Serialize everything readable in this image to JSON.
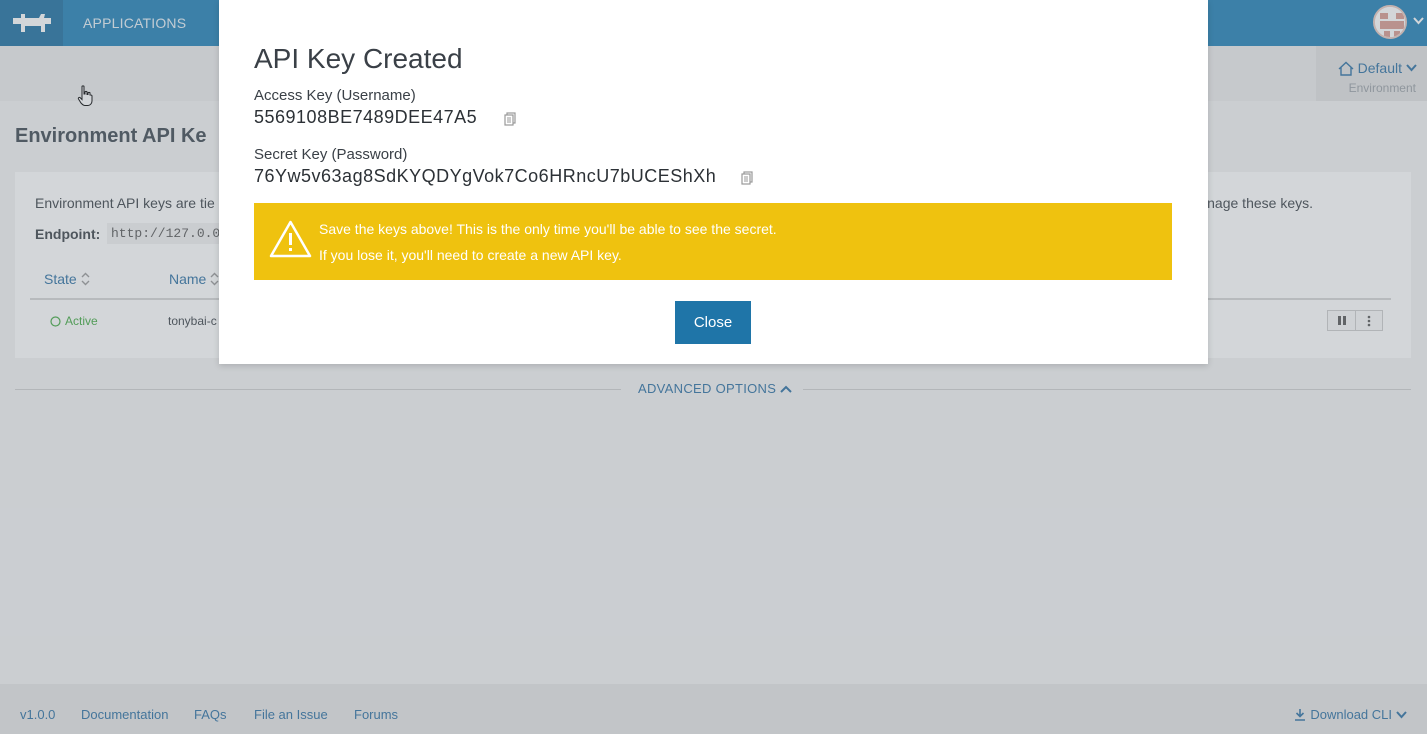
{
  "topbar": {
    "nav_applications": "APPLICATIONS"
  },
  "environment": {
    "name": "Default",
    "label": "Environment"
  },
  "page": {
    "title": "Environment API Ke",
    "description": "Environment API keys are tie",
    "description_tail": "nage these keys.",
    "endpoint_label": "Endpoint:",
    "endpoint_value": "http://127.0.0."
  },
  "table": {
    "headers": {
      "state": "State",
      "name": "Name"
    },
    "rows": [
      {
        "state": "Active",
        "name": "tonybai-c"
      }
    ]
  },
  "advanced_options": "ADVANCED OPTIONS",
  "footer": {
    "version": "v1.0.0",
    "documentation": "Documentation",
    "faqs": "FAQs",
    "file_issue": "File an Issue",
    "forums": "Forums",
    "download_cli": "Download CLI"
  },
  "modal": {
    "title": "API Key Created",
    "access_key_label": "Access Key (Username)",
    "access_key_value": "5569108BE7489DEE47A5",
    "secret_key_label": "Secret Key (Password)",
    "secret_key_value": "76Yw5v63ag8SdKYQDYgVok7Co6HRncU7bUCEShXh",
    "warning_line1": "Save the keys above! This is the only time you'll be able to see the secret.",
    "warning_line2": "If you lose it, you'll need to create a new API key.",
    "close_label": "Close"
  },
  "colors": {
    "topbar": "#1f7fb6",
    "warning": "#efc20f",
    "primary_button": "#1f75a8",
    "link": "#2b6fa3",
    "active": "#3fa93f"
  }
}
